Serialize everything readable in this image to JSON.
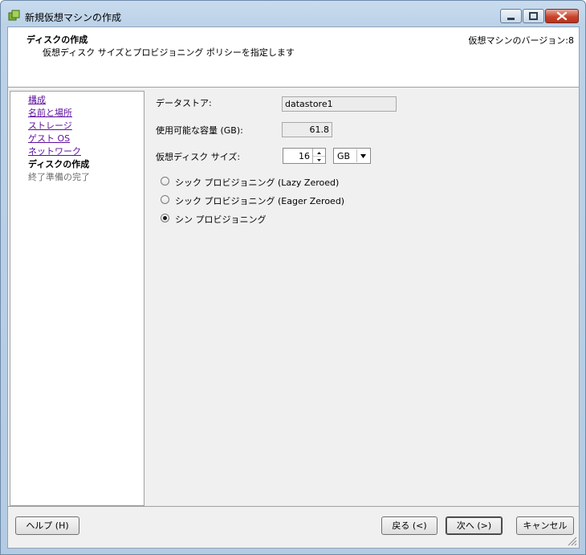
{
  "window": {
    "title": "新規仮想マシンの作成",
    "buttons": {
      "minimize": "minimize-icon",
      "maximize": "maximize-icon",
      "close": "close-icon"
    }
  },
  "header": {
    "title": "ディスクの作成",
    "subtitle": "仮想ディスク サイズとプロビジョニング ポリシーを指定します",
    "version": "仮想マシンのバージョン:8"
  },
  "nav": {
    "items": [
      {
        "label": "構成",
        "state": "link"
      },
      {
        "label": "名前と場所",
        "state": "link"
      },
      {
        "label": "ストレージ",
        "state": "link"
      },
      {
        "label": "ゲスト OS",
        "state": "link"
      },
      {
        "label": "ネットワーク",
        "state": "link"
      },
      {
        "label": "ディスクの作成",
        "state": "current"
      },
      {
        "label": "終了準備の完了",
        "state": "disabled"
      }
    ]
  },
  "form": {
    "datastore_label": "データストア:",
    "datastore_value": "datastore1",
    "capacity_label": "使用可能な容量 (GB):",
    "capacity_value": "61.8",
    "size_label": "仮想ディスク サイズ:",
    "size_value": "16",
    "size_unit": "GB",
    "provisioning": [
      {
        "label": "シック プロビジョニング (Lazy Zeroed)",
        "selected": false
      },
      {
        "label": "シック プロビジョニング (Eager Zeroed)",
        "selected": false
      },
      {
        "label": "シン プロビジョニング",
        "selected": true
      }
    ]
  },
  "footer": {
    "help": "ヘルプ (H)",
    "back": "戻る (<)",
    "next": "次へ (>)",
    "cancel": "キャンセル"
  },
  "colors": {
    "link": "#5d0f9e",
    "disabled": "#6d6d6d",
    "close_button": "#c9442c",
    "frame": "#bcd2e8"
  }
}
